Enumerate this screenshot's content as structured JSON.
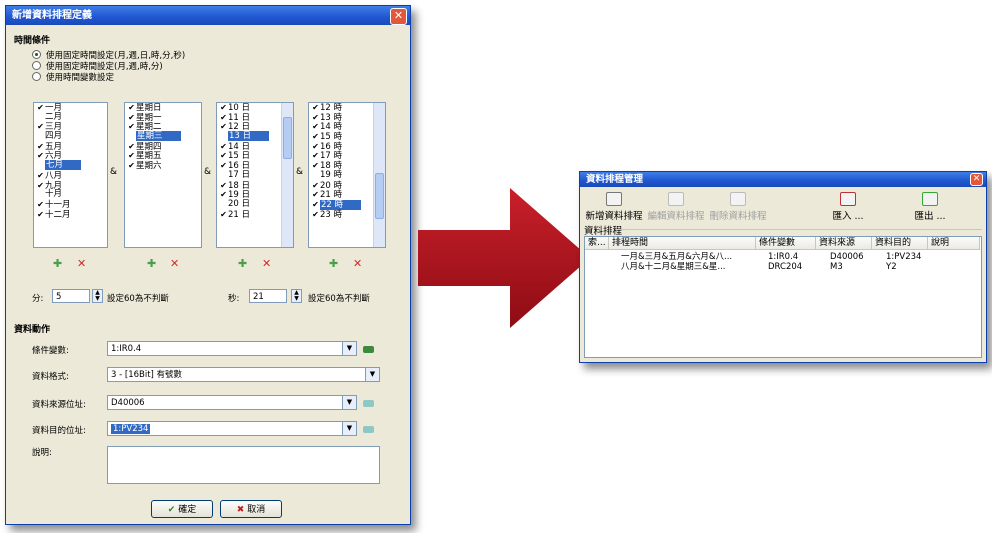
{
  "dialog": {
    "title": "新增資料排程定義",
    "close_glyph": "✕",
    "time_group_label": "時間條件",
    "radios": [
      {
        "label": "使用固定時間設定(月,週,日,時,分,秒)",
        "selected": true
      },
      {
        "label": "使用固定時間設定(月,週,時,分)",
        "selected": false
      },
      {
        "label": "使用時間變數設定",
        "selected": false
      }
    ],
    "months": [
      {
        "label": "一月",
        "checked": true
      },
      {
        "label": "二月",
        "checked": false
      },
      {
        "label": "三月",
        "checked": true
      },
      {
        "label": "四月",
        "checked": false
      },
      {
        "label": "五月",
        "checked": true
      },
      {
        "label": "六月",
        "checked": true
      },
      {
        "label": "七月",
        "checked": false,
        "highlighted": true
      },
      {
        "label": "八月",
        "checked": true
      },
      {
        "label": "九月",
        "checked": true
      },
      {
        "label": "十月",
        "checked": false
      },
      {
        "label": "十一月",
        "checked": true
      },
      {
        "label": "十二月",
        "checked": true
      }
    ],
    "weekdays": [
      {
        "label": "星期日",
        "checked": true
      },
      {
        "label": "星期一",
        "checked": true
      },
      {
        "label": "星期二",
        "checked": true
      },
      {
        "label": "星期三",
        "checked": false,
        "highlighted": true
      },
      {
        "label": "星期四",
        "checked": true
      },
      {
        "label": "星期五",
        "checked": true
      },
      {
        "label": "星期六",
        "checked": true
      }
    ],
    "days": [
      {
        "label": "10 日",
        "checked": true
      },
      {
        "label": "11 日",
        "checked": true
      },
      {
        "label": "12 日",
        "checked": true
      },
      {
        "label": "13 日",
        "checked": false,
        "highlighted": true
      },
      {
        "label": "14 日",
        "checked": true
      },
      {
        "label": "15 日",
        "checked": true
      },
      {
        "label": "16 日",
        "checked": true
      },
      {
        "label": "17 日",
        "checked": false
      },
      {
        "label": "18 日",
        "checked": true
      },
      {
        "label": "19 日",
        "checked": true
      },
      {
        "label": "20 日",
        "checked": false
      },
      {
        "label": "21 日",
        "checked": true
      }
    ],
    "hours": [
      {
        "label": "12 時",
        "checked": true
      },
      {
        "label": "13 時",
        "checked": true
      },
      {
        "label": "14 時",
        "checked": true
      },
      {
        "label": "15 時",
        "checked": true
      },
      {
        "label": "16 時",
        "checked": true
      },
      {
        "label": "17 時",
        "checked": true
      },
      {
        "label": "18 時",
        "checked": true
      },
      {
        "label": "19 時",
        "checked": false
      },
      {
        "label": "20 時",
        "checked": true
      },
      {
        "label": "21 時",
        "checked": true
      },
      {
        "label": "22 時",
        "checked": true,
        "highlighted": true
      },
      {
        "label": "23 時",
        "checked": true
      }
    ],
    "amp": "&",
    "add_glyph": "✚",
    "del_glyph": "✕",
    "check_glyph": "✔",
    "minute_label": "分:",
    "minute_value": "5",
    "minute_note": "設定60為不判斷",
    "second_label": "秒:",
    "second_value": "21",
    "second_note": "設定60為不判斷",
    "action_group_label": "資料動作",
    "condition_var_label": "條件變數:",
    "condition_var_value": "1:IR0.4",
    "data_format_label": "資料格式:",
    "data_format_value": "3 - [16Bit] 有號數",
    "source_addr_label": "資料來源位址:",
    "source_addr_value": "D40006",
    "target_addr_label": "資料目的位址:",
    "target_addr_value": "1:PV234",
    "desc_label": "說明:",
    "desc_value": "",
    "ok_label": "確定",
    "cancel_label": "取消",
    "ok_glyph": "✔",
    "cancel_glyph": "✖"
  },
  "manager": {
    "title": "資料排程管理",
    "close_glyph": "✕",
    "toolbar": [
      {
        "label": "新增資料排程",
        "enabled": true,
        "icon": "add-schedule-icon"
      },
      {
        "label": "編輯資料排程",
        "enabled": false,
        "icon": "edit-schedule-icon"
      },
      {
        "label": "刪除資料排程",
        "enabled": false,
        "icon": "delete-schedule-icon"
      },
      {
        "label": "匯入 ...",
        "enabled": true,
        "icon": "import-icon"
      },
      {
        "label": "匯出 ...",
        "enabled": true,
        "icon": "export-icon"
      }
    ],
    "section_label": "資料排程",
    "columns": [
      "索...",
      "排程時間",
      "條件變數",
      "資料來源",
      "資料目的",
      "說明"
    ],
    "rows": [
      [
        "",
        "一月&三月&五月&六月&八...",
        "1:IR0.4",
        "D40006",
        "1:PV234",
        ""
      ],
      [
        "",
        "八月&十二月&星期三&星...",
        "DRC204",
        "M3",
        "Y2",
        ""
      ]
    ]
  },
  "colors": {
    "arrow": "#b0121c",
    "titlebar": "#1f56d0",
    "highlight": "#316ac5"
  }
}
